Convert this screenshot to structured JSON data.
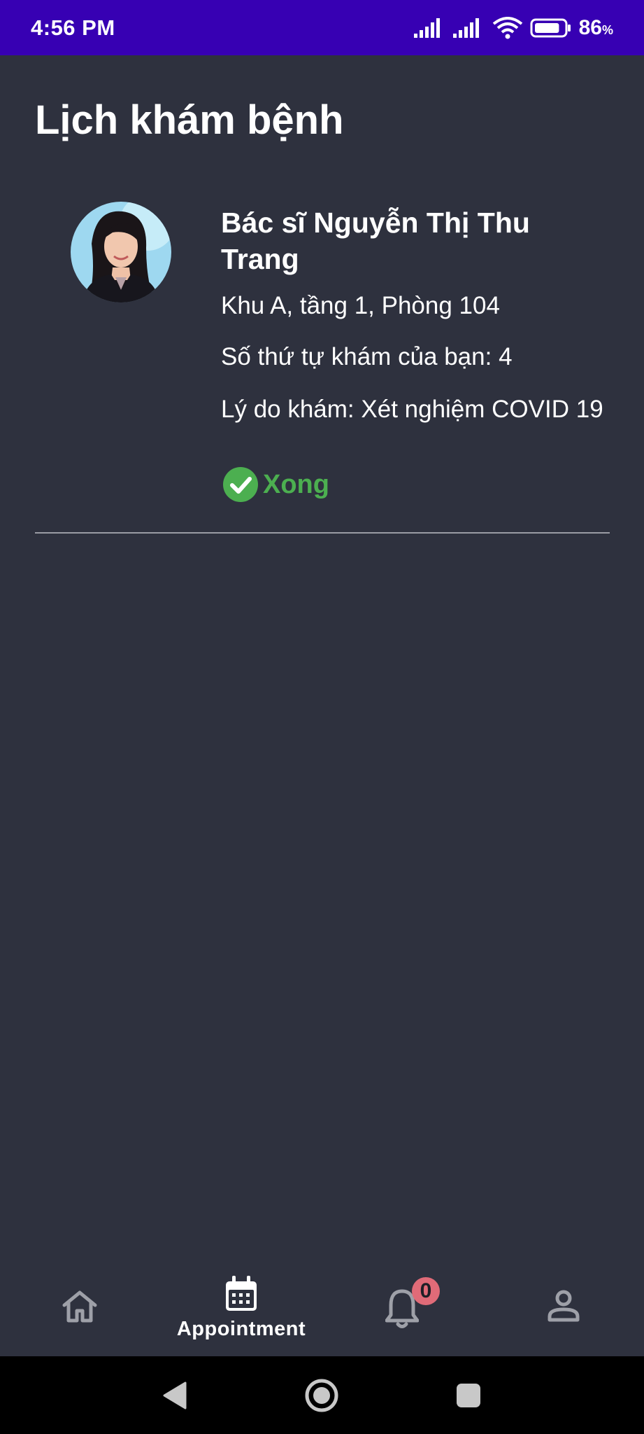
{
  "status_bar": {
    "time": "4:56 PM",
    "battery_percent": "86",
    "battery_unit": "%",
    "battery_level": 0.86
  },
  "page": {
    "title": "Lịch khám bệnh"
  },
  "appointment": {
    "doctor_name": "Bác sĩ Nguyễn Thị Thu Trang",
    "location": "Khu A, tầng 1, Phòng 104",
    "queue_number": "Số thứ tự khám của bạn: 4",
    "reason": "Lý do khám: Xét nghiệm COVID 19",
    "status": "Xong",
    "status_color": "#4caf50"
  },
  "bottom_nav": {
    "items": [
      {
        "id": "home",
        "icon": "home-icon",
        "label": "",
        "active": false
      },
      {
        "id": "appointment",
        "icon": "calendar-icon",
        "label": "Appointment",
        "active": true
      },
      {
        "id": "notifications",
        "icon": "bell-icon",
        "label": "",
        "badge": "0",
        "active": false
      },
      {
        "id": "profile",
        "icon": "person-icon",
        "label": "",
        "active": false
      }
    ]
  },
  "colors": {
    "status_bar": "#3700b3",
    "background": "#2e313e",
    "accent_done": "#4caf50",
    "badge": "#e06b78",
    "inactive_icon": "#9ea0a8"
  }
}
